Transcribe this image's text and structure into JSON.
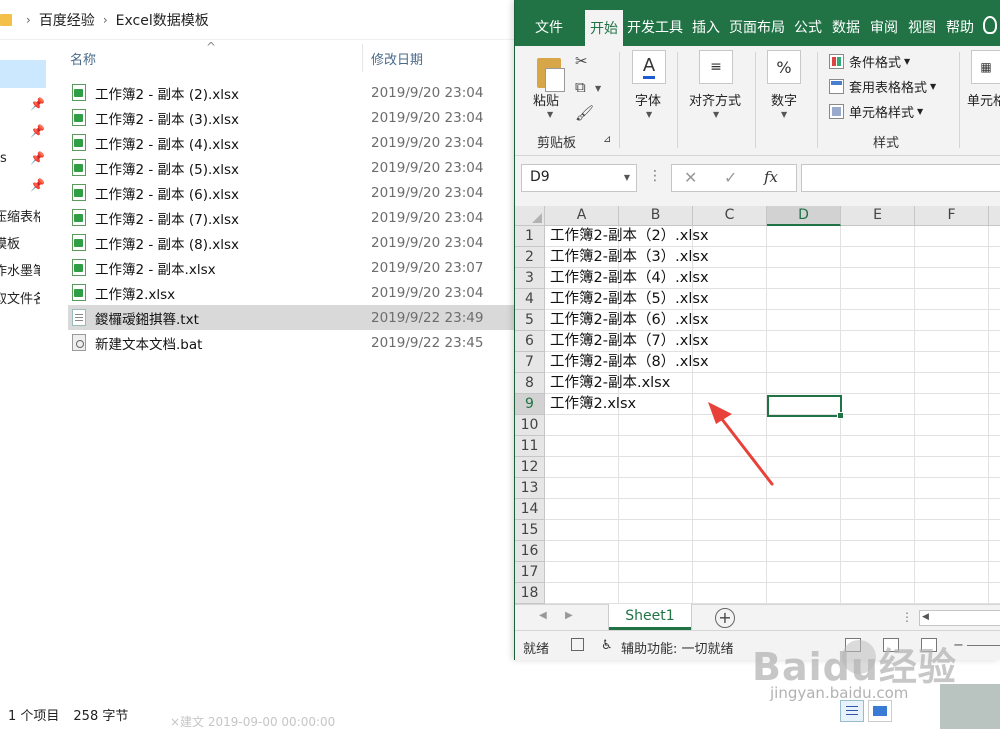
{
  "explorer": {
    "breadcrumb": [
      "百度经验",
      "Excel数据模板"
    ],
    "nav_items": [
      {
        "label": "s"
      },
      {
        "label": "压缩表格"
      },
      {
        "label": "模板"
      },
      {
        "label": "作水墨笔"
      },
      {
        "label": "取文件名"
      }
    ],
    "columns": {
      "name": "名称",
      "date": "修改日期"
    },
    "files": [
      {
        "name": "工作簿2 - 副本 (2).xlsx",
        "date": "2019/9/20 23:04",
        "type": "xlsx"
      },
      {
        "name": "工作簿2 - 副本 (3).xlsx",
        "date": "2019/9/20 23:04",
        "type": "xlsx"
      },
      {
        "name": "工作簿2 - 副本 (4).xlsx",
        "date": "2019/9/20 23:04",
        "type": "xlsx"
      },
      {
        "name": "工作簿2 - 副本 (5).xlsx",
        "date": "2019/9/20 23:04",
        "type": "xlsx"
      },
      {
        "name": "工作簿2 - 副本 (6).xlsx",
        "date": "2019/9/20 23:04",
        "type": "xlsx"
      },
      {
        "name": "工作簿2 - 副本 (7).xlsx",
        "date": "2019/9/20 23:04",
        "type": "xlsx"
      },
      {
        "name": "工作簿2 - 副本 (8).xlsx",
        "date": "2019/9/20 23:04",
        "type": "xlsx"
      },
      {
        "name": "工作簿2 - 副本.xlsx",
        "date": "2019/9/20 23:07",
        "type": "xlsx"
      },
      {
        "name": "工作簿2.xlsx",
        "date": "2019/9/20 23:04",
        "type": "xlsx"
      },
      {
        "name": "鍐欏叆鎺掑簭.txt",
        "date": "2019/9/22 23:49",
        "type": "txt",
        "selected": true
      },
      {
        "name": "新建文本文档.bat",
        "date": "2019/9/22 23:45",
        "type": "bat"
      }
    ],
    "status": {
      "count": "1 个项目",
      "size": "258 字节"
    },
    "faded_text": "×建文 2019-09-00 00:00:00"
  },
  "excel": {
    "tabs": [
      "文件",
      "开始",
      "开发工具",
      "插入",
      "页面布局",
      "公式",
      "数据",
      "审阅",
      "视图",
      "帮助"
    ],
    "active_tab": "开始",
    "ribbon": {
      "paste": "粘贴",
      "clipboard": "剪贴板",
      "font": "字体",
      "font_icon": "A",
      "align": "对齐方式",
      "number": "数字",
      "number_icon": "%",
      "conditional_format": "条件格式",
      "table_format": "套用表格格式",
      "cell_styles": "单元格样式",
      "styles": "样式",
      "cells": "单元格"
    },
    "name_box": "D9",
    "fx_label": "fx",
    "columns": [
      "A",
      "B",
      "C",
      "D",
      "E",
      "F"
    ],
    "selected_column": "D",
    "rows": [
      "1",
      "2",
      "3",
      "4",
      "5",
      "6",
      "7",
      "8",
      "9",
      "10",
      "11",
      "12",
      "13",
      "14",
      "15",
      "16",
      "17",
      "18"
    ],
    "selected_row": "9",
    "cells_a": [
      "工作簿2-副本（2）.xlsx",
      "工作簿2-副本（3）.xlsx",
      "工作簿2-副本（4）.xlsx",
      "工作簿2-副本（5）.xlsx",
      "工作簿2-副本（6）.xlsx",
      "工作簿2-副本（7）.xlsx",
      "工作簿2-副本（8）.xlsx",
      "工作簿2-副本.xlsx",
      "工作簿2.xlsx"
    ],
    "sheet_tab": "Sheet1",
    "add_sheet": "+",
    "status_ready": "就绪",
    "status_accessibility": "辅助功能: 一切就绪"
  },
  "watermark": {
    "main": "Baidu经验",
    "sub": "jingyan.baidu.com"
  },
  "colors": {
    "excel_green": "#217346",
    "selection": "#cce8ff",
    "arrow": "#e8413a"
  }
}
